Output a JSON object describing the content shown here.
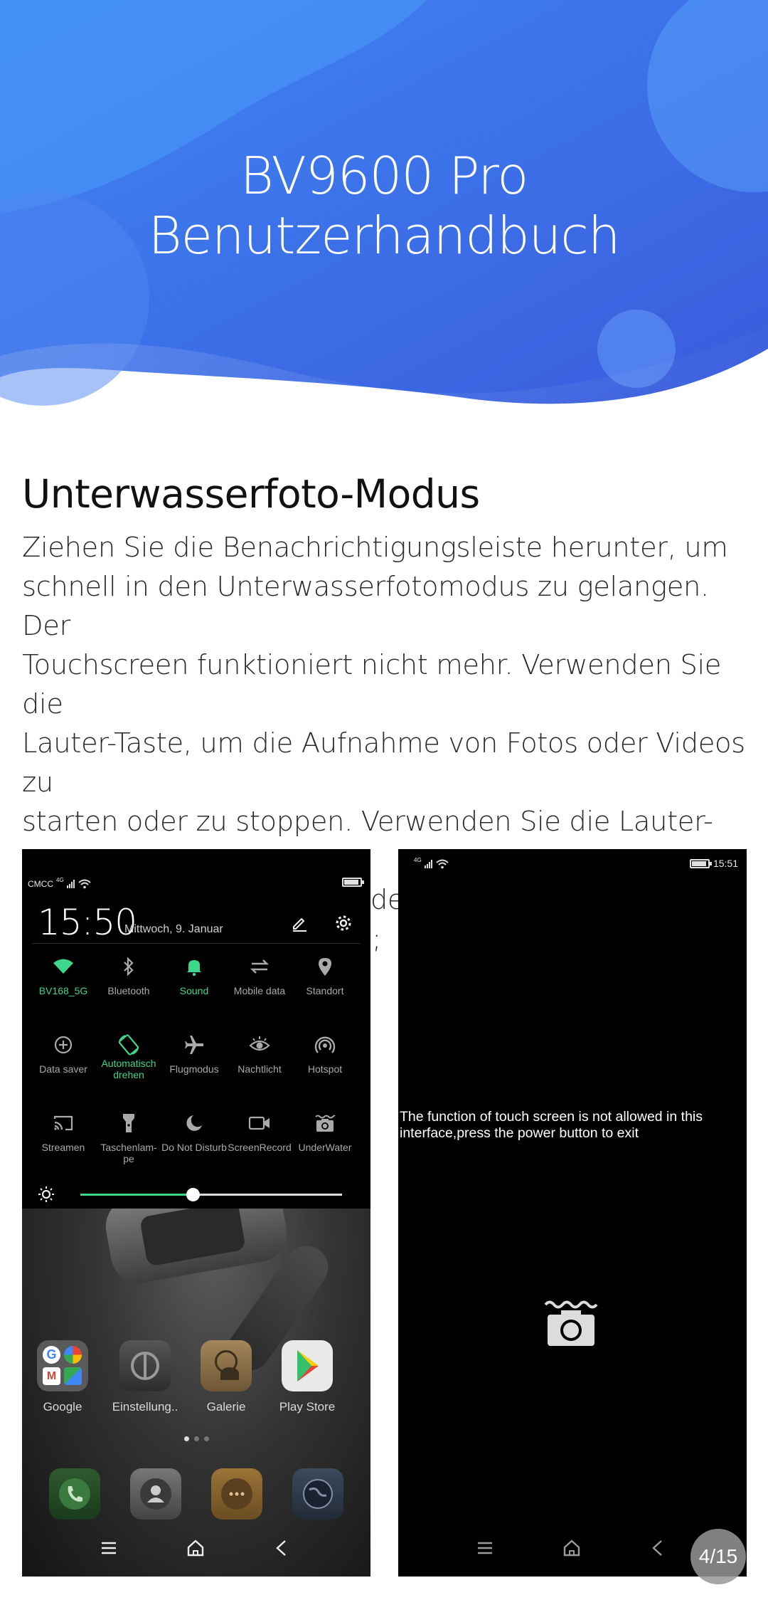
{
  "header": {
    "title": "BV9600 Pro Benutzerhandbuch"
  },
  "section": {
    "title": "Unterwasserfoto-Modus",
    "lines": [
      "Ziehen Sie die Benachrichtigungsleiste herunter, um",
      "schnell in den Unterwasserfotomodus zu gelangen. Der",
      "Touchscreen funktioniert nicht mehr. Verwenden Sie die",
      "Lauter-Taste, um die Aufnahme von Fotos oder Videos zu",
      "starten oder zu stoppen. Verwenden Sie die Lauter-Taste,",
      "um zwischen Fotos und Videos zu wechseln Ein- /",
      "Ausschalter zum Beenden;"
    ]
  },
  "phone_left": {
    "carrier": "CMCC",
    "network": "4G",
    "time": "15:50",
    "date": "Mittwoch, 9. Januar",
    "tiles": [
      {
        "label": "BV168_5G",
        "icon": "wifi-icon",
        "on": true
      },
      {
        "label": "Bluetooth",
        "icon": "bluetooth-icon",
        "on": false
      },
      {
        "label": "Sound",
        "icon": "bell-icon",
        "on": true
      },
      {
        "label": "Mobile data",
        "icon": "data-arrows-icon",
        "on": false
      },
      {
        "label": "Standort",
        "icon": "location-icon",
        "on": false
      },
      {
        "label": "Data saver",
        "icon": "data-saver-icon",
        "on": false
      },
      {
        "label": "Automatisch drehen",
        "icon": "rotate-icon",
        "on": true
      },
      {
        "label": "Flugmodus",
        "icon": "airplane-icon",
        "on": false
      },
      {
        "label": "Nachtlicht",
        "icon": "eye-icon",
        "on": false
      },
      {
        "label": "Hotspot",
        "icon": "hotspot-icon",
        "on": false
      },
      {
        "label": "Streamen",
        "icon": "cast-icon",
        "on": false
      },
      {
        "label": "Taschenlam-pe",
        "icon": "flashlight-icon",
        "on": false
      },
      {
        "label": "Do Not Disturb",
        "icon": "moon-icon",
        "on": false
      },
      {
        "label": "ScreenRecord",
        "icon": "video-camera-icon",
        "on": false
      },
      {
        "label": "UnderWater",
        "icon": "underwater-camera-icon",
        "on": false
      }
    ],
    "brightness": 0.43,
    "apps": [
      "Google",
      "Einstellung..",
      "Galerie",
      "Play Store"
    ],
    "home_page": {
      "current": 1,
      "total": 3
    }
  },
  "phone_right": {
    "network": "4G",
    "time": "15:51",
    "message_line1": "The function of touch screen is not allowed in this",
    "message_line2": "interface,press the power button to exit"
  },
  "page_indicator": "4/15",
  "colors": {
    "header_blue": "#3f7ef0",
    "active_green": "#3ed68b"
  }
}
